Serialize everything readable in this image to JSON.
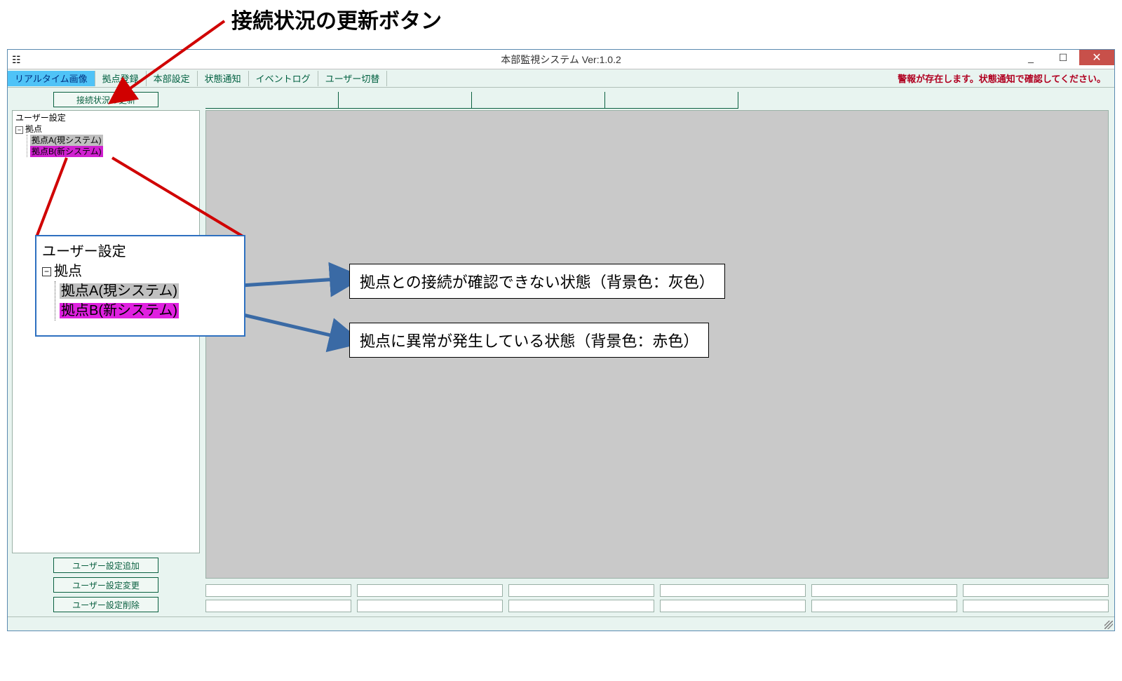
{
  "annotation": {
    "title": "接続状況の更新ボタン"
  },
  "window": {
    "title": "本部監視システム Ver:1.0.2",
    "warning": "警報が存在します。状態通知で確認してください。"
  },
  "toolbar": {
    "items": [
      "リアルタイム画像",
      "拠点登録",
      "本部設定",
      "状態通知",
      "イベントログ",
      "ユーザー切替"
    ],
    "active_index": 0
  },
  "sidebar": {
    "refresh_label": "接続状況の更新",
    "tree": {
      "root_items": [
        "ユーザー設定",
        "拠点"
      ],
      "leaves": [
        {
          "label": "拠点A(現システム)",
          "state": "gray"
        },
        {
          "label": "拠点B(新システム)",
          "state": "magenta"
        }
      ]
    },
    "buttons": [
      "ユーザー設定追加",
      "ユーザー設定変更",
      "ユーザー設定削除"
    ]
  },
  "zoom_tree": {
    "root_items": [
      "ユーザー設定",
      "拠点"
    ],
    "leaves": [
      {
        "label": "拠点A(現システム)",
        "state": "gray"
      },
      {
        "label": "拠点B(新システム)",
        "state": "magenta"
      }
    ]
  },
  "callouts": {
    "c1": "拠点との接続が確認できない状態（背景色：灰色）",
    "c2": "拠点に異常が発生している状態（背景色：赤色）"
  },
  "glyphs": {
    "minus": "−",
    "minimize": "_",
    "maximize": "☐",
    "close": "✕"
  }
}
